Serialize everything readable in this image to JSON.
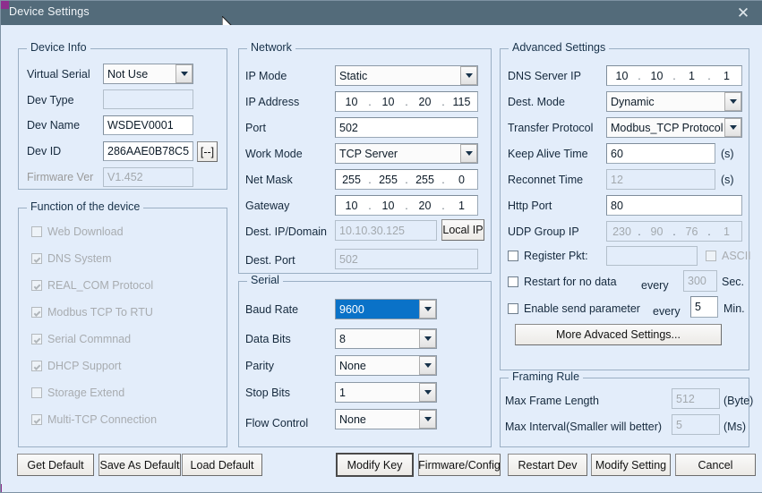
{
  "window": {
    "title": "Device Settings",
    "close_icon": "close-icon"
  },
  "device_info": {
    "legend": "Device Info",
    "virtual_serial": {
      "label": "Virtual Serial",
      "value": "Not Use"
    },
    "dev_type": {
      "label": "Dev Type",
      "value": ""
    },
    "dev_name": {
      "label": "Dev Name",
      "value": "WSDEV0001"
    },
    "dev_id": {
      "label": "Dev ID",
      "value": "286AAE0B78C5",
      "button": "[--]"
    },
    "firmware_ver": {
      "label": "Firmware Ver",
      "value": "V1.452"
    }
  },
  "function_group": {
    "legend": "Function of the device",
    "items": [
      {
        "label": "Web Download",
        "checked": false
      },
      {
        "label": "DNS System",
        "checked": true
      },
      {
        "label": "REAL_COM Protocol",
        "checked": true
      },
      {
        "label": "Modbus TCP To RTU",
        "checked": true
      },
      {
        "label": "Serial Commnad",
        "checked": true
      },
      {
        "label": "DHCP Support",
        "checked": true
      },
      {
        "label": "Storage Extend",
        "checked": false
      },
      {
        "label": "Multi-TCP Connection",
        "checked": true
      }
    ]
  },
  "network": {
    "legend": "Network",
    "ip_mode": {
      "label": "IP Mode",
      "value": "Static"
    },
    "ip_address": {
      "label": "IP Address",
      "octets": [
        "10",
        "10",
        "20",
        "115"
      ]
    },
    "port": {
      "label": "Port",
      "value": "502"
    },
    "work_mode": {
      "label": "Work Mode",
      "value": "TCP Server"
    },
    "net_mask": {
      "label": "Net Mask",
      "octets": [
        "255",
        "255",
        "255",
        "0"
      ]
    },
    "gateway": {
      "label": "Gateway",
      "octets": [
        "10",
        "10",
        "20",
        "1"
      ]
    },
    "dest_ip": {
      "label": "Dest. IP/Domain",
      "value": "10.10.30.125",
      "button": "Local IP"
    },
    "dest_port": {
      "label": "Dest. Port",
      "value": "502"
    }
  },
  "serial": {
    "legend": "Serial",
    "baud_rate": {
      "label": "Baud Rate",
      "value": "9600"
    },
    "data_bits": {
      "label": "Data Bits",
      "value": "8"
    },
    "parity": {
      "label": "Parity",
      "value": "None"
    },
    "stop_bits": {
      "label": "Stop Bits",
      "value": "1"
    },
    "flow_control": {
      "label": "Flow Control",
      "value": "None"
    }
  },
  "advanced": {
    "legend": "Advanced Settings",
    "dns_server_ip": {
      "label": "DNS Server IP",
      "octets": [
        "10",
        "10",
        "1",
        "1"
      ]
    },
    "dest_mode": {
      "label": "Dest. Mode",
      "value": "Dynamic"
    },
    "transfer_protocol": {
      "label": "Transfer Protocol",
      "value": "Modbus_TCP Protocol"
    },
    "keep_alive_time": {
      "label": "Keep Alive Time",
      "value": "60",
      "unit": "(s)"
    },
    "reconnet_time": {
      "label": "Reconnet Time",
      "value": "12",
      "unit": "(s)"
    },
    "http_port": {
      "label": "Http Port",
      "value": "80"
    },
    "udp_group_ip": {
      "label": "UDP Group IP",
      "octets": [
        "230",
        "90",
        "76",
        "1"
      ]
    },
    "register_pkt": {
      "label": "Register Pkt:",
      "value": "",
      "checked": false
    },
    "ascii": {
      "label": "ASCII",
      "checked": false
    },
    "restart_no_data": {
      "label": "Restart for no data",
      "checked": false,
      "every": "every",
      "value": "300",
      "unit": "Sec."
    },
    "enable_send_param": {
      "label": "Enable send parameter",
      "checked": false,
      "every": "every",
      "value": "5",
      "unit": "Min."
    },
    "more_button": "More Advaced Settings..."
  },
  "framing": {
    "legend": "Framing Rule",
    "max_frame_length": {
      "label": "Max Frame Length",
      "value": "512",
      "unit": "(Byte)"
    },
    "max_interval": {
      "label": "Max Interval(Smaller will better)",
      "value": "5",
      "unit": "(Ms)"
    }
  },
  "footer": {
    "get_default": "Get Default",
    "save_as_default": "Save As Default",
    "load_default": "Load Default",
    "modify_key": "Modify Key",
    "firmware_config": "Firmware/Config",
    "restart_dev": "Restart Dev",
    "modify_setting": "Modify Setting",
    "cancel": "Cancel"
  },
  "colors": {
    "titlebar": "#536b7a",
    "client_bg": "#e3edfa",
    "group_border": "#9bafc4",
    "selection": "#0a72c8",
    "corner_accent": "#8d2f8d"
  }
}
